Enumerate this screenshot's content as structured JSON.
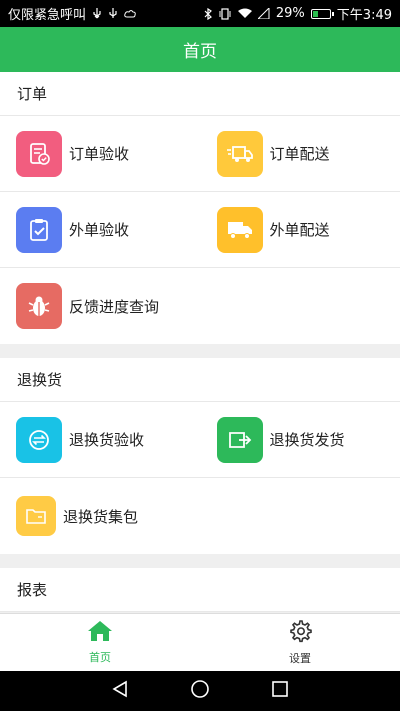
{
  "status_bar": {
    "carrier": "仅限紧急呼叫",
    "battery": "29%",
    "time": "下午3:49"
  },
  "header": {
    "title": "首页"
  },
  "sections": [
    {
      "title": "订单",
      "items": [
        {
          "label": "订单验收",
          "icon": "clipboard-check-icon",
          "color": "#f25d7f"
        },
        {
          "label": "订单配送",
          "icon": "delivery-truck-icon",
          "color": "#ffc93b"
        },
        {
          "label": "外单验收",
          "icon": "clipboard-checkmark-icon",
          "color": "#5b7df1"
        },
        {
          "label": "外单配送",
          "icon": "truck-icon",
          "color": "#ffc02b"
        },
        {
          "label": "反馈进度查询",
          "icon": "bug-icon",
          "color": "#e66b63"
        }
      ]
    },
    {
      "title": "退换货",
      "items": [
        {
          "label": "退换货验收",
          "icon": "exchange-icon",
          "color": "#19c2e6"
        },
        {
          "label": "退换货发货",
          "icon": "ship-out-icon",
          "color": "#2db95a"
        },
        {
          "label": "退换货集包",
          "icon": "folder-icon",
          "color": "#ffcb45"
        }
      ]
    },
    {
      "title": "报表",
      "items": []
    }
  ],
  "bottom_nav": {
    "home_label": "首页",
    "settings_label": "设置",
    "accent_color": "#2db95a"
  }
}
